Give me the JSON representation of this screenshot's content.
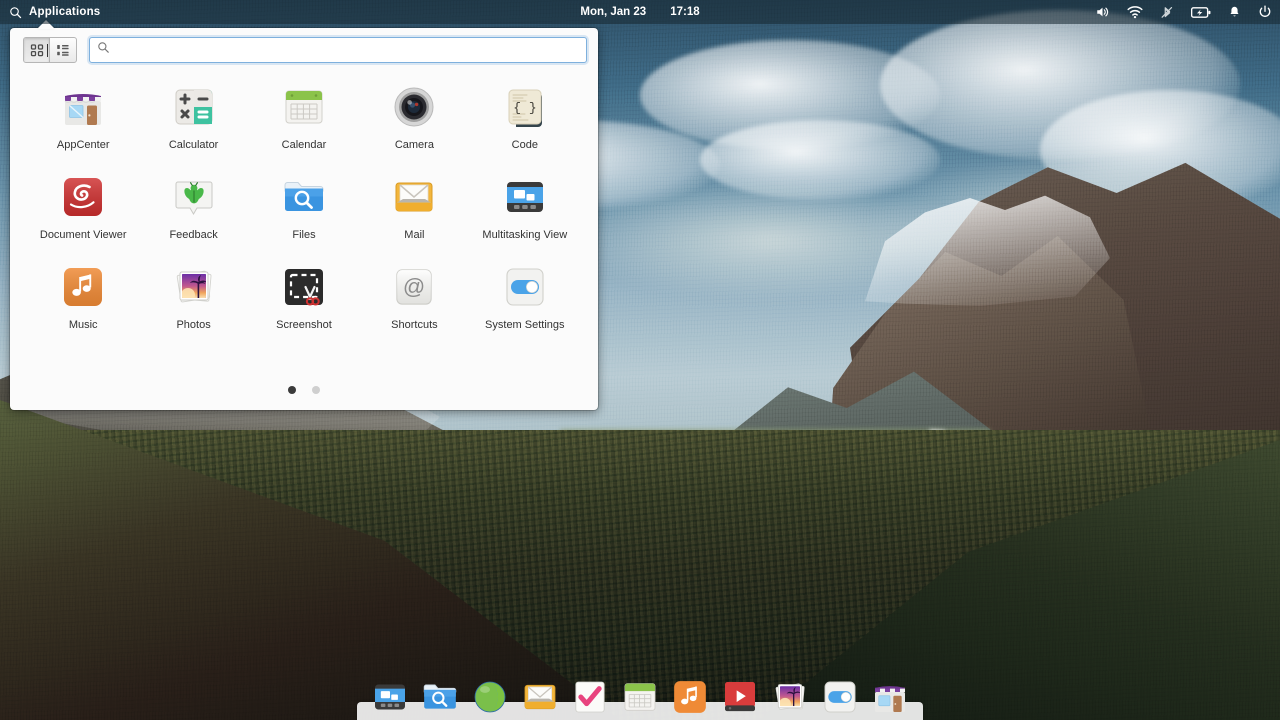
{
  "panel": {
    "applications_label": "Applications",
    "search_icon": "search-icon",
    "date": "Mon, Jan 23",
    "time": "17:18",
    "indicators": [
      {
        "name": "volume-icon",
        "label": "Sound"
      },
      {
        "name": "wifi-icon",
        "label": "Network"
      },
      {
        "name": "bluetooth-disabled-icon",
        "label": "Bluetooth"
      },
      {
        "name": "battery-charging-icon",
        "label": "Power"
      },
      {
        "name": "notification-bell-icon",
        "label": "Notifications"
      },
      {
        "name": "power-icon",
        "label": "Session"
      }
    ]
  },
  "launcher": {
    "view_grid_label": "Grid view",
    "view_category_label": "Category view",
    "search": {
      "value": "",
      "placeholder": ""
    },
    "apps": [
      {
        "name": "AppCenter",
        "icon": "appcenter-icon"
      },
      {
        "name": "Calculator",
        "icon": "calculator-icon"
      },
      {
        "name": "Calendar",
        "icon": "calendar-icon"
      },
      {
        "name": "Camera",
        "icon": "camera-icon"
      },
      {
        "name": "Code",
        "icon": "code-icon"
      },
      {
        "name": "Document Viewer",
        "icon": "document-viewer-icon"
      },
      {
        "name": "Feedback",
        "icon": "feedback-icon"
      },
      {
        "name": "Files",
        "icon": "files-icon"
      },
      {
        "name": "Mail",
        "icon": "mail-icon"
      },
      {
        "name": "Multitasking View",
        "icon": "multitasking-view-icon"
      },
      {
        "name": "Music",
        "icon": "music-icon"
      },
      {
        "name": "Photos",
        "icon": "photos-icon"
      },
      {
        "name": "Screenshot",
        "icon": "screenshot-icon"
      },
      {
        "name": "Shortcuts",
        "icon": "shortcuts-icon"
      },
      {
        "name": "System Settings",
        "icon": "system-settings-icon"
      }
    ],
    "pages": {
      "count": 2,
      "active": 1
    }
  },
  "dock": {
    "items": [
      {
        "name": "Multitasking View",
        "icon": "multitasking-view-icon"
      },
      {
        "name": "Files",
        "icon": "files-icon"
      },
      {
        "name": "Web Browser",
        "icon": "web-browser-icon"
      },
      {
        "name": "Mail",
        "icon": "mail-icon"
      },
      {
        "name": "Tasks",
        "icon": "tasks-icon"
      },
      {
        "name": "Calendar",
        "icon": "calendar-icon"
      },
      {
        "name": "Music",
        "icon": "music-icon"
      },
      {
        "name": "Videos",
        "icon": "videos-icon"
      },
      {
        "name": "Photos",
        "icon": "photos-icon"
      },
      {
        "name": "System Settings",
        "icon": "system-settings-icon"
      },
      {
        "name": "AppCenter",
        "icon": "appcenter-icon"
      }
    ]
  },
  "colors": {
    "panel_bg": "#16262f",
    "launcher_bg": "#fbfbfb",
    "accent_focus": "#7eb0dd",
    "label_text": "#333333",
    "dock_bg": "#f4f4f4"
  }
}
